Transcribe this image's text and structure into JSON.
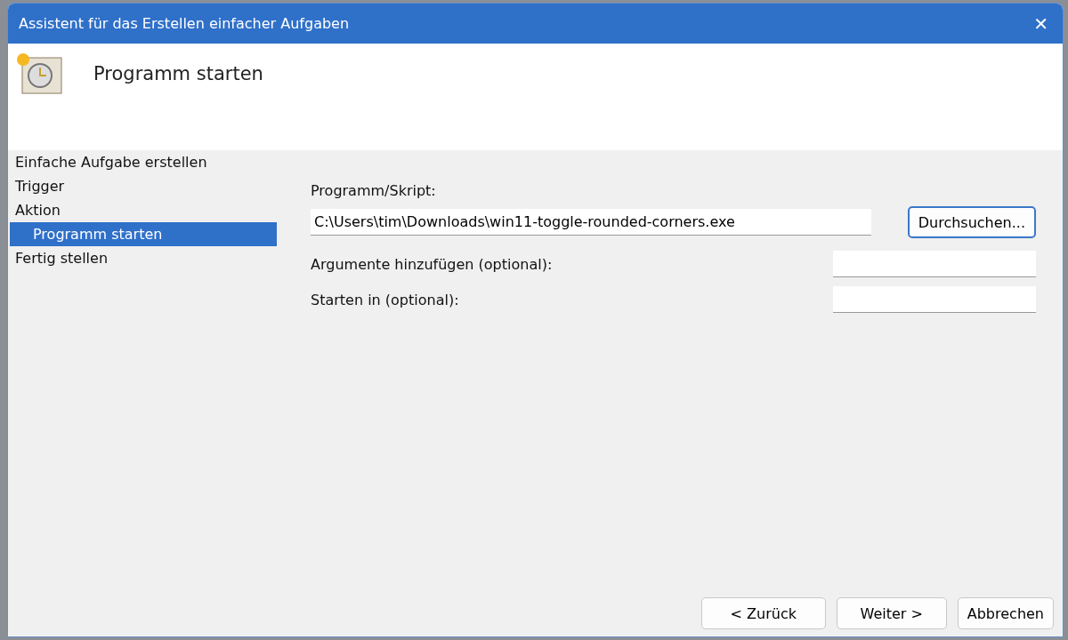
{
  "window": {
    "title": "Assistent für das Erstellen einfacher Aufgaben",
    "close": "✕"
  },
  "header": {
    "title": "Programm starten"
  },
  "steps": [
    {
      "label": "Einfache Aufgabe erstellen",
      "selected": false
    },
    {
      "label": "Trigger",
      "selected": false
    },
    {
      "label": "Aktion",
      "selected": false,
      "children": [
        {
          "label": "Programm starten",
          "selected": true
        }
      ]
    },
    {
      "label": "Fertig stellen",
      "selected": false
    }
  ],
  "program": {
    "label": "Programm/Skript:",
    "value": "C:\\Users\\tim\\Downloads\\win11-toggle-rounded-corners.exe",
    "browse": "Durchsuchen..."
  },
  "fields": [
    {
      "label": "Argumente hinzufügen (optional):"
    },
    {
      "label": "Starten in (optional):"
    }
  ],
  "buttons": [
    "< Zurück",
    "Weiter >",
    "Abbrechen"
  ]
}
